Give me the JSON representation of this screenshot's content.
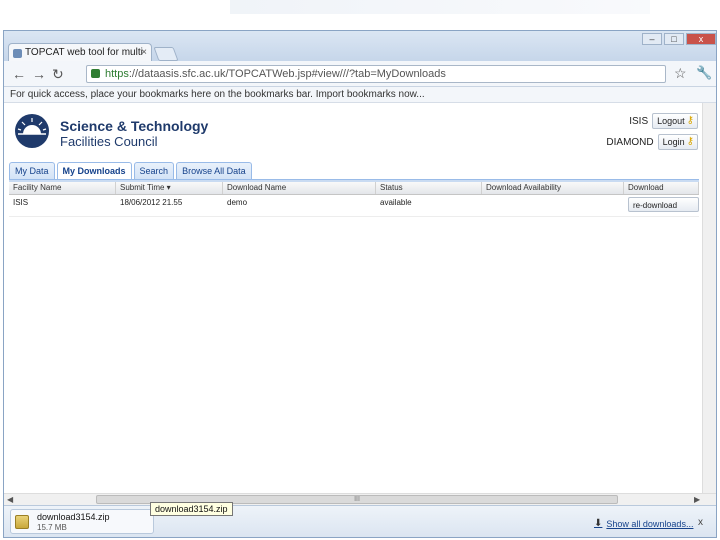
{
  "browser": {
    "tab_title": "TOPCAT web tool for multi",
    "tab_close": "×",
    "url_https": "https",
    "url_rest": "://dataasis.sfc.ac.uk/TOPCATWeb.jsp#view///?tab=MyDownloads",
    "bookmarks_bar_text": "For quick access, place your bookmarks here on the bookmarks bar. Import bookmarks now...",
    "controls": {
      "minimize": "–",
      "maximize": "□",
      "close": "x"
    }
  },
  "header": {
    "org_line1": "Science & Technology",
    "org_line2": "Facilities Council"
  },
  "facilities": [
    {
      "name": "ISIS",
      "button": "Logout"
    },
    {
      "name": "DIAMOND",
      "button": "Login"
    }
  ],
  "tabs": [
    {
      "label": "My Data"
    },
    {
      "label": "My Downloads"
    },
    {
      "label": "Search"
    },
    {
      "label": "Browse All Data"
    }
  ],
  "grid": {
    "columns": [
      "Facility Name",
      "Submit Time ▾",
      "Download Name",
      "Status",
      "Download Availability",
      "Download"
    ],
    "rows": [
      {
        "facility": "ISIS",
        "submit_time": "18/06/2012 21.55",
        "download_name": "demo",
        "status": "available",
        "availability": "",
        "action": "re-download"
      }
    ]
  },
  "scrollbar": {
    "thumb_grip": "III"
  },
  "download_shelf": {
    "file_name": "download3154.zip",
    "file_size": "15.7 MB",
    "tooltip": "download3154.zip",
    "show_all": "Show all downloads...",
    "close": "x"
  },
  "colors": {
    "brand": "#1f3a6b",
    "tab_text": "#15428b",
    "window_frame": "#c6d6ea"
  }
}
